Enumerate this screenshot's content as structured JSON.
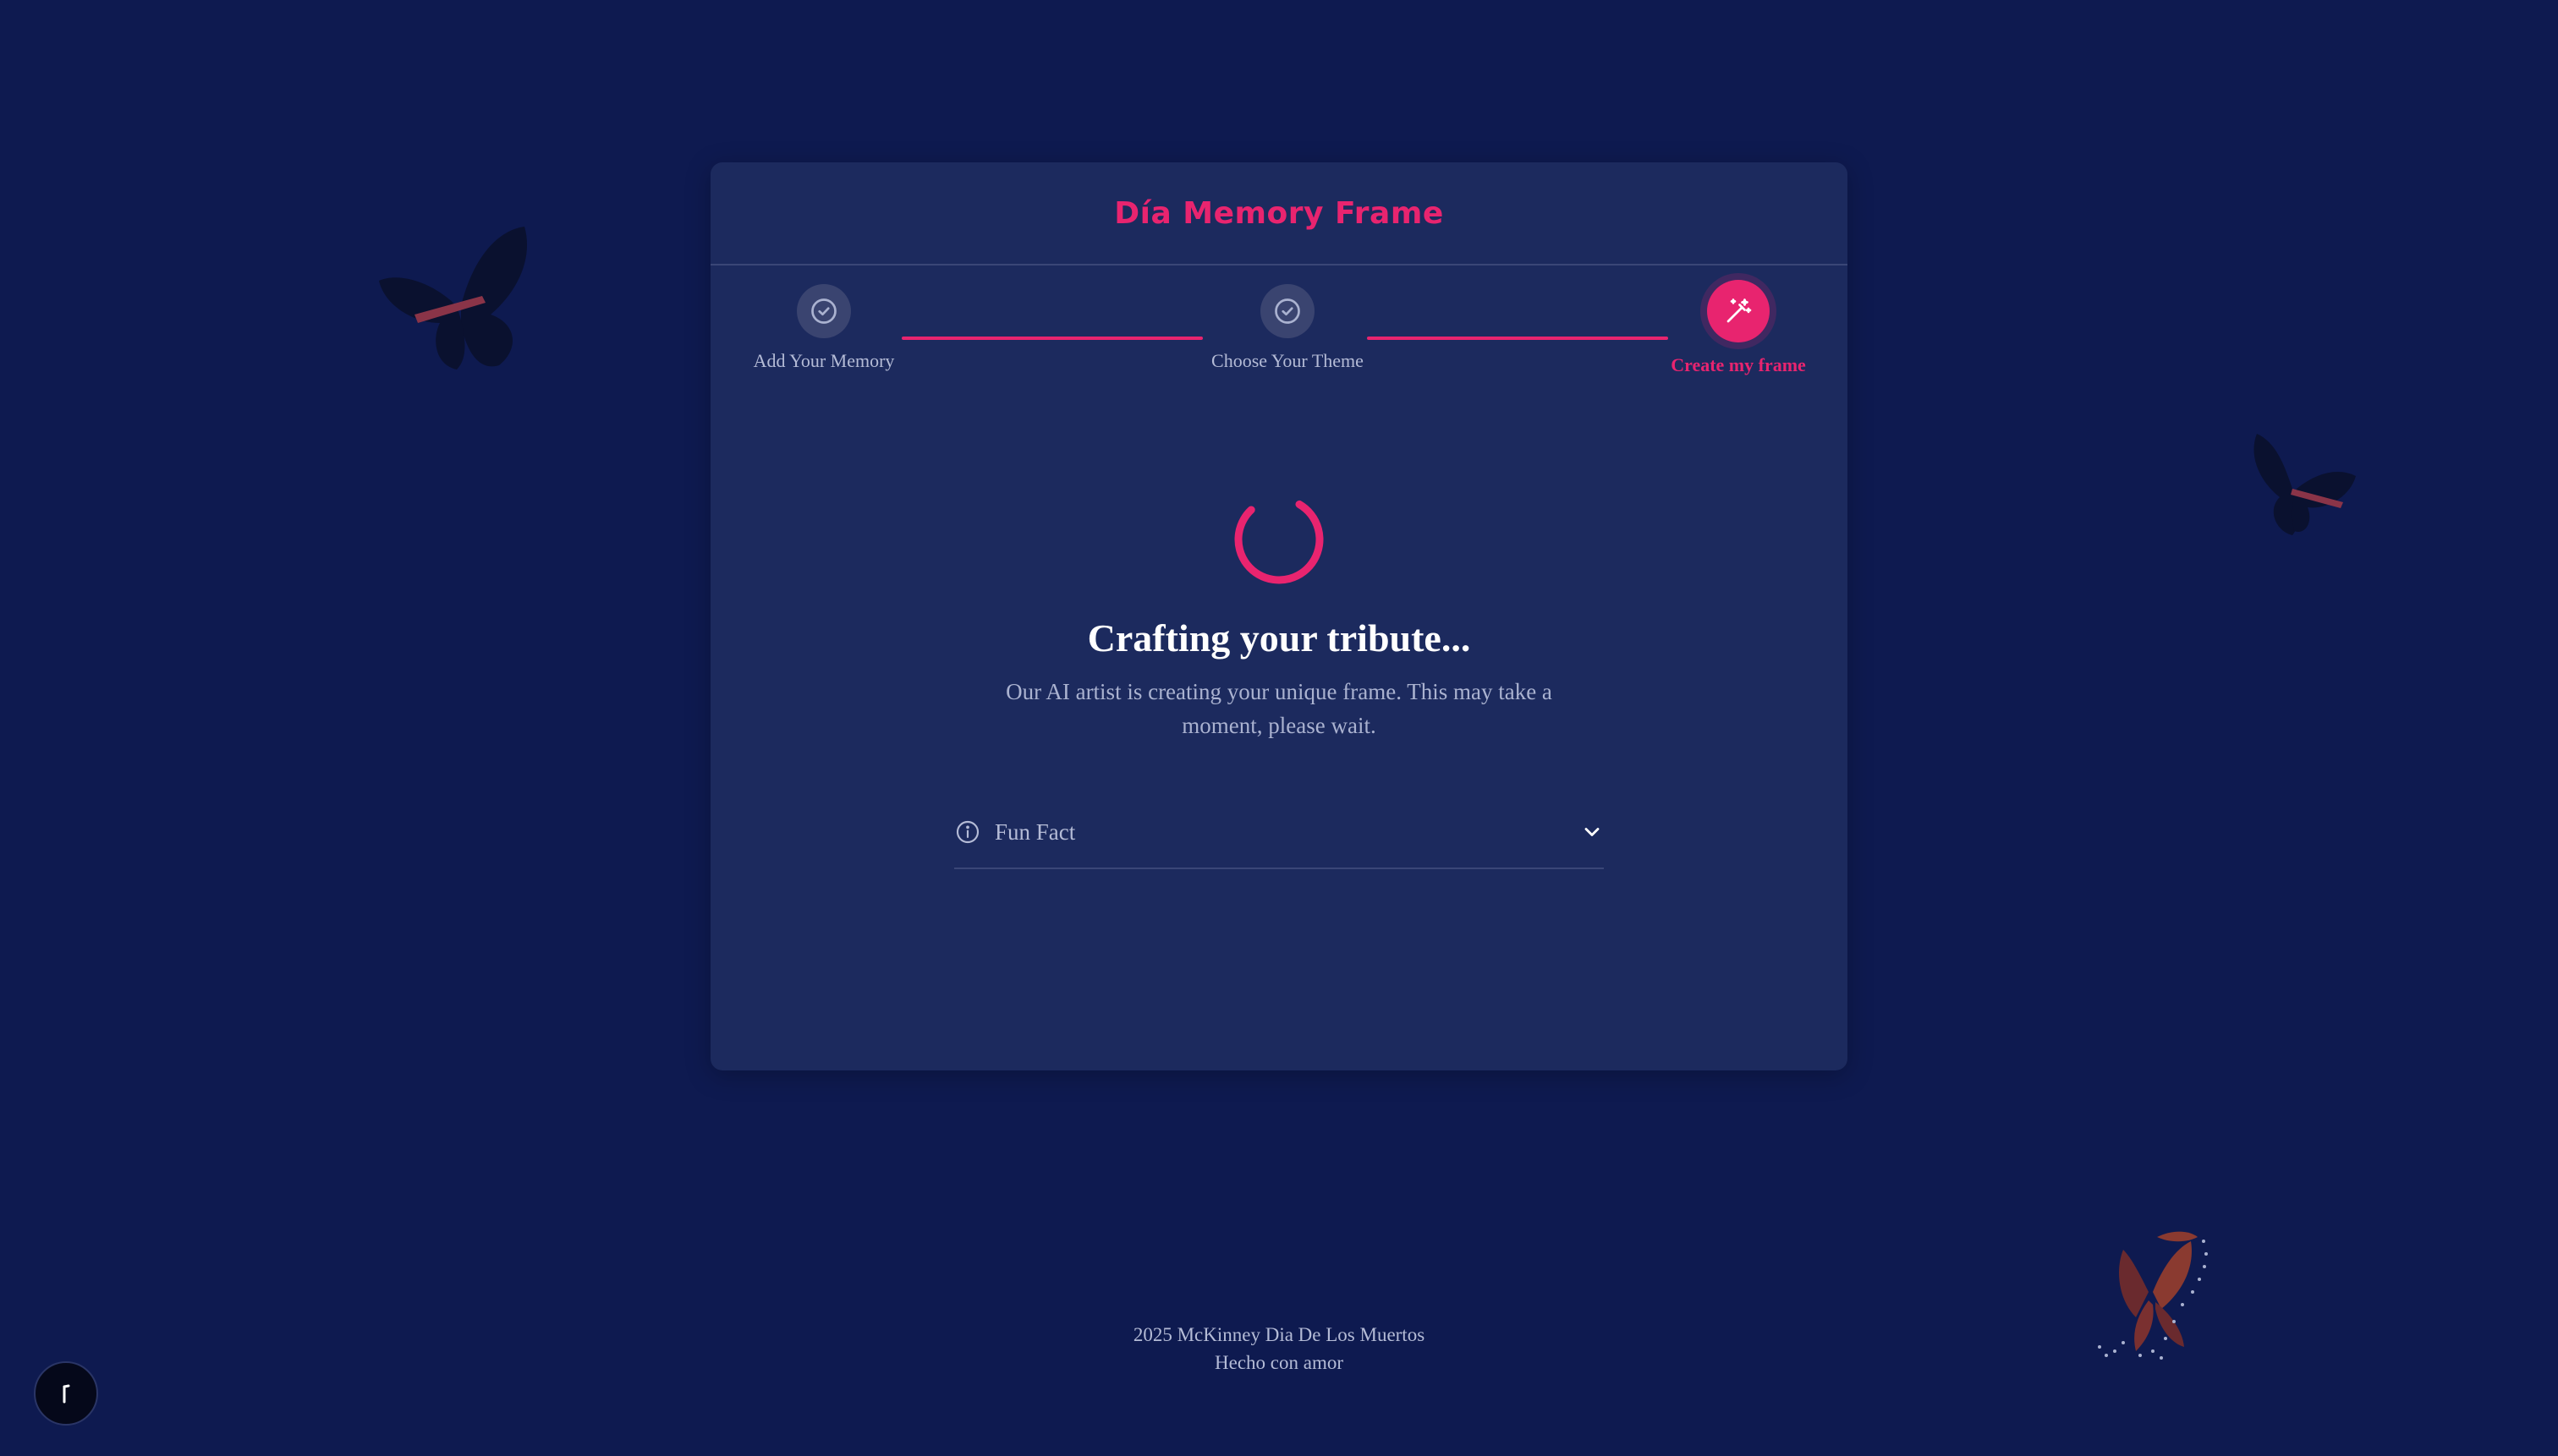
{
  "header": {
    "title": "Día Memory Frame"
  },
  "stepper": {
    "steps": [
      {
        "label": "Add Your Memory",
        "state": "complete",
        "icon": "check-circle-icon"
      },
      {
        "label": "Choose Your Theme",
        "state": "complete",
        "icon": "check-circle-icon"
      },
      {
        "label": "Create my frame",
        "state": "active",
        "icon": "magic-wand-icon"
      }
    ]
  },
  "loading": {
    "heading": "Crafting your tribute...",
    "message": "Our AI artist is creating your unique frame. This may take a moment, please wait."
  },
  "fun_fact": {
    "label": "Fun Fact",
    "expanded": false
  },
  "footer": {
    "line1": "2025 McKinney Dia De Los Muertos",
    "line2": "Hecho con amor"
  },
  "colors": {
    "background": "#0e1a50",
    "card": "#1c2a5e",
    "accent": "#e8246f",
    "muted_text": "#b4bbd6"
  }
}
